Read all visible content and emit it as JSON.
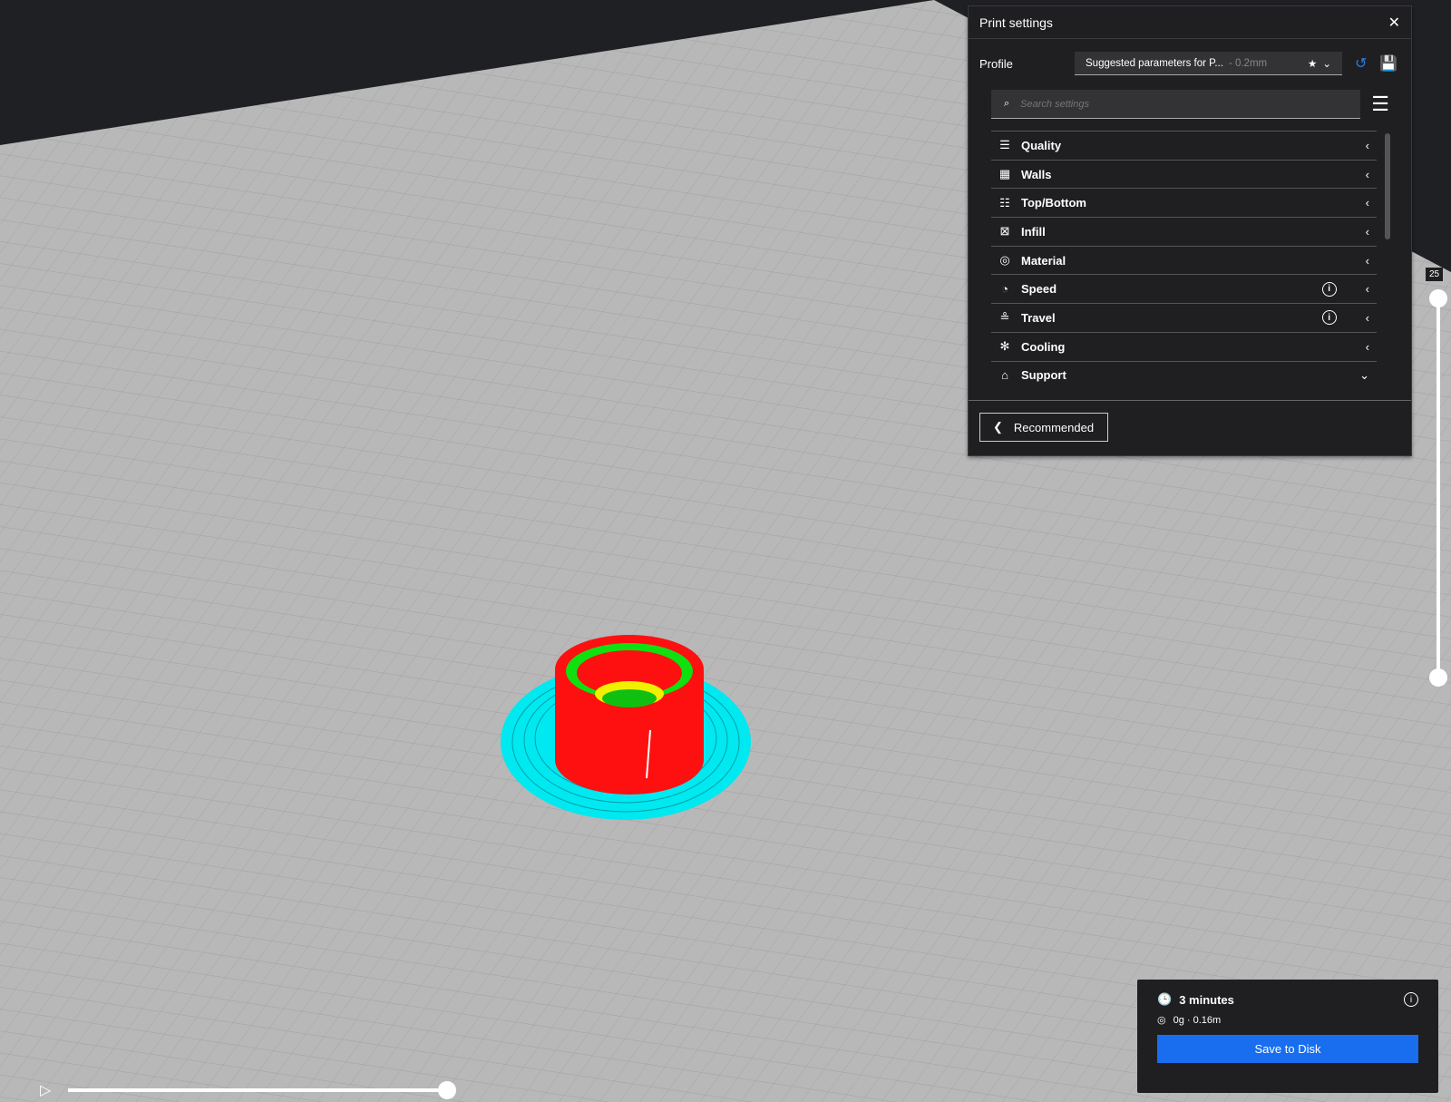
{
  "panel": {
    "title": "Print settings",
    "profile_label": "Profile",
    "profile_name": "Suggested parameters for P...",
    "profile_layer": "- 0.2mm",
    "search_placeholder": "Search settings",
    "categories": [
      {
        "label": "Quality",
        "icon": "quality-icon",
        "glyph": "☰",
        "info": false,
        "open": false
      },
      {
        "label": "Walls",
        "icon": "walls-icon",
        "glyph": "▦",
        "info": false,
        "open": false
      },
      {
        "label": "Top/Bottom",
        "icon": "top-bottom-icon",
        "glyph": "☷",
        "info": false,
        "open": false
      },
      {
        "label": "Infill",
        "icon": "infill-icon",
        "glyph": "⊠",
        "info": false,
        "open": false
      },
      {
        "label": "Material",
        "icon": "material-icon",
        "glyph": "◎",
        "info": false,
        "open": false
      },
      {
        "label": "Speed",
        "icon": "speed-icon",
        "glyph": "◔",
        "info": true,
        "open": false
      },
      {
        "label": "Travel",
        "icon": "travel-icon",
        "glyph": "≗",
        "info": true,
        "open": false
      },
      {
        "label": "Cooling",
        "icon": "cooling-icon",
        "glyph": "✻",
        "info": false,
        "open": false
      },
      {
        "label": "Support",
        "icon": "support-icon",
        "glyph": "⌂",
        "info": false,
        "open": true
      }
    ],
    "recommended_label": "Recommended"
  },
  "layer_slider": {
    "value": "25"
  },
  "summary": {
    "time": "3 minutes",
    "material": "0g · 0.16m",
    "save_label": "Save to Disk"
  },
  "colors": {
    "accent": "#196ef0",
    "wall_outer": "#ff0000",
    "wall_inner": "#00ff00",
    "skirt": "#00ffff",
    "skin": "#ffff00"
  }
}
